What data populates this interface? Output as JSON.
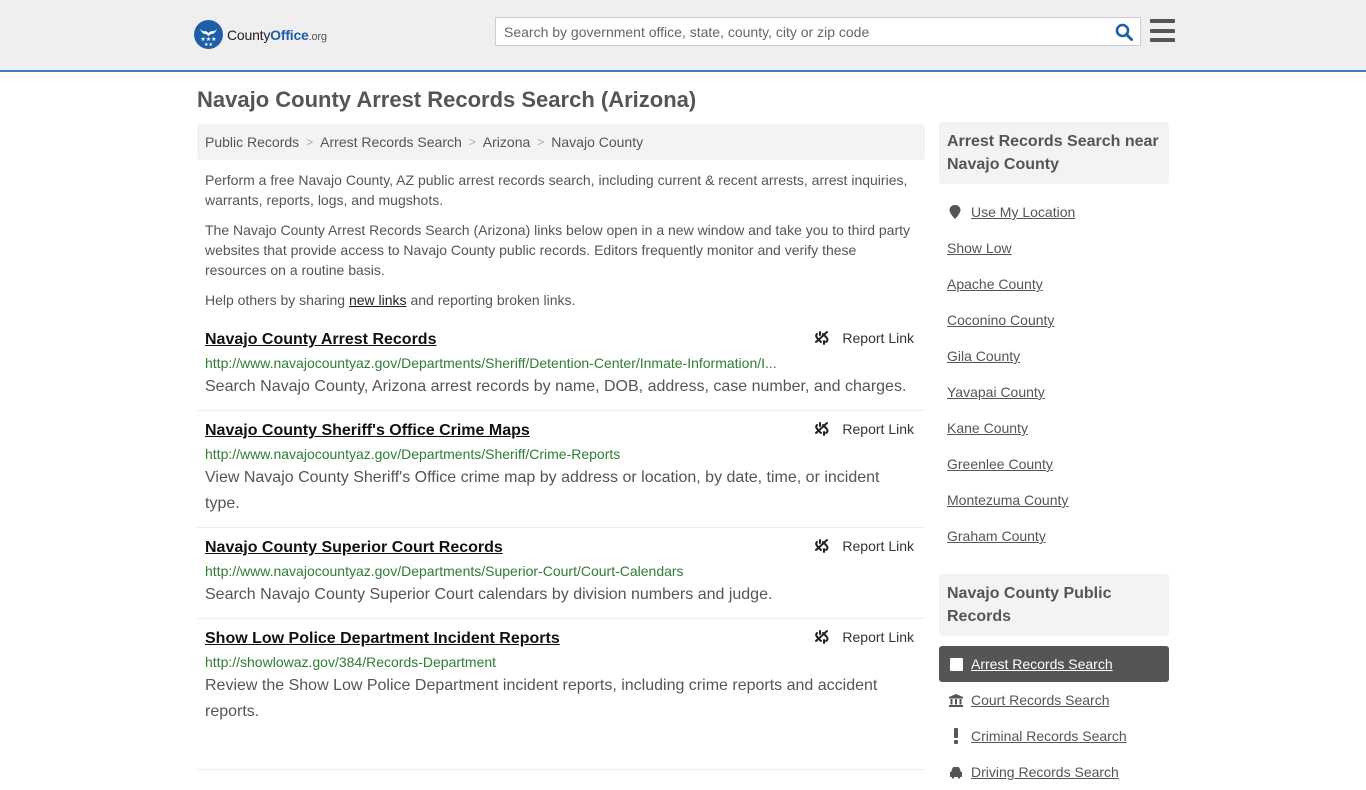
{
  "header": {
    "logo_county": "County",
    "logo_office": "Office",
    "logo_org": ".org",
    "search_placeholder": "Search by government office, state, county, city or zip code",
    "search_value": "",
    "accent_color": "#1d5fa8"
  },
  "page": {
    "title": "Navajo County Arrest Records Search (Arizona)"
  },
  "breadcrumb": [
    {
      "label": "Public Records"
    },
    {
      "label": "Arrest Records Search"
    },
    {
      "label": "Arizona"
    },
    {
      "label": "Navajo County"
    }
  ],
  "intro": {
    "p1": "Perform a free Navajo County, AZ public arrest records search, including current & recent arrests, arrest inquiries, warrants, reports, logs, and mugshots.",
    "p2": "The Navajo County Arrest Records Search (Arizona) links below open in a new window and take you to third party websites that provide access to Navajo County public records. Editors frequently monitor and verify these resources on a routine basis.",
    "p3_before": "Help others by sharing ",
    "p3_link": "new links",
    "p3_after": " and reporting broken links."
  },
  "results": [
    {
      "title": "Navajo County Arrest Records",
      "url": "http://www.navajocountyaz.gov/Departments/Sheriff/Detention-Center/Inmate-Information/I...",
      "description": "Search Navajo County, Arizona arrest records by name, DOB, address, case number, and charges.",
      "report_label": "Report Link"
    },
    {
      "title": "Navajo County Sheriff's Office Crime Maps",
      "url": "http://www.navajocountyaz.gov/Departments/Sheriff/Crime-Reports",
      "description": "View Navajo County Sheriff's Office crime map by address or location, by date, time, or incident type.",
      "report_label": "Report Link"
    },
    {
      "title": "Navajo County Superior Court Records",
      "url": "http://www.navajocountyaz.gov/Departments/Superior-Court/Court-Calendars",
      "description": "Search Navajo County Superior Court calendars by division numbers and judge.",
      "report_label": "Report Link"
    },
    {
      "title": "Show Low Police Department Incident Reports",
      "url": "http://showlowaz.gov/384/Records-Department",
      "description": "Review the Show Low Police Department incident reports, including crime reports and accident reports.",
      "report_label": "Report Link"
    }
  ],
  "sidebar": {
    "nearby_title": "Arrest Records Search near Navajo County",
    "use_location": "Use My Location",
    "nearby": [
      "Show Low",
      "Apache County",
      "Coconino County",
      "Gila County",
      "Yavapai County",
      "Kane County",
      "Greenlee County",
      "Montezuma County",
      "Graham County"
    ],
    "records_title": "Navajo County Public Records",
    "records": [
      {
        "label": "Arrest Records Search",
        "icon": "square-icon",
        "active": true
      },
      {
        "label": "Court Records Search",
        "icon": "courthouse-icon",
        "active": false
      },
      {
        "label": "Criminal Records Search",
        "icon": "exclamation-icon",
        "active": false
      },
      {
        "label": "Driving Records Search",
        "icon": "car-icon",
        "active": false
      }
    ]
  }
}
